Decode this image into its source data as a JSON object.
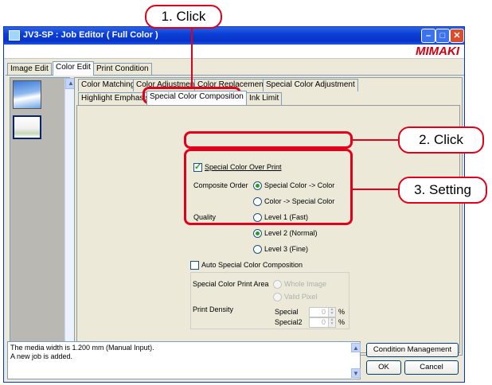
{
  "window": {
    "title": "JV3-SP : Job Editor ( Full Color )",
    "brand": "MIMAKI",
    "buttons": {
      "minimize": "–",
      "maximize": "□",
      "close": "✕"
    }
  },
  "main_tabs": [
    {
      "label": "Image Edit",
      "active": false
    },
    {
      "label": "Color Edit",
      "active": true
    },
    {
      "label": "Print Condition",
      "active": false
    }
  ],
  "sub_tabs_row1": [
    {
      "label": "Color Matching"
    },
    {
      "label": "Color Adjustment"
    },
    {
      "label": "Color Replacement"
    },
    {
      "label": "Special Color Adjustment"
    }
  ],
  "sub_tabs_row2": [
    {
      "label": "Highlight Emphasis"
    },
    {
      "label": "Special Color Composition"
    },
    {
      "label": "Ink Limit"
    }
  ],
  "form": {
    "over_print": {
      "label": "Special Color Over Print",
      "checked": true
    },
    "composite_order": {
      "label": "Composite Order",
      "options": [
        "Special Color -> Color",
        "Color -> Special Color"
      ],
      "selected": "Special Color -> Color"
    },
    "quality": {
      "label": "Quality",
      "options": [
        "Level 1 (Fast)",
        "Level 2 (Normal)",
        "Level 3 (Fine)"
      ],
      "selected": "Level 2 (Normal)"
    },
    "auto_composition": {
      "label": "Auto Special Color Composition",
      "checked": false
    },
    "print_area": {
      "label": "Special Color Print Area",
      "options": [
        "Whole Image",
        "Valid Pixel"
      ],
      "selected": "Whole Image"
    },
    "print_density": {
      "label": "Print Density",
      "special": {
        "label": "Special",
        "value": "0",
        "unit": "%"
      },
      "special2": {
        "label": "Special2",
        "value": "0",
        "unit": "%"
      }
    }
  },
  "status": {
    "lines": [
      "The media width is 1.200 mm (Manual Input).",
      "A new job is added."
    ]
  },
  "buttons": {
    "condition_management": "Condition Management",
    "ok": "OK",
    "cancel": "Cancel"
  },
  "annotations": {
    "step1": "1. Click",
    "step2": "2. Click",
    "step3": "3. Setting",
    "color": "#e0001b"
  }
}
